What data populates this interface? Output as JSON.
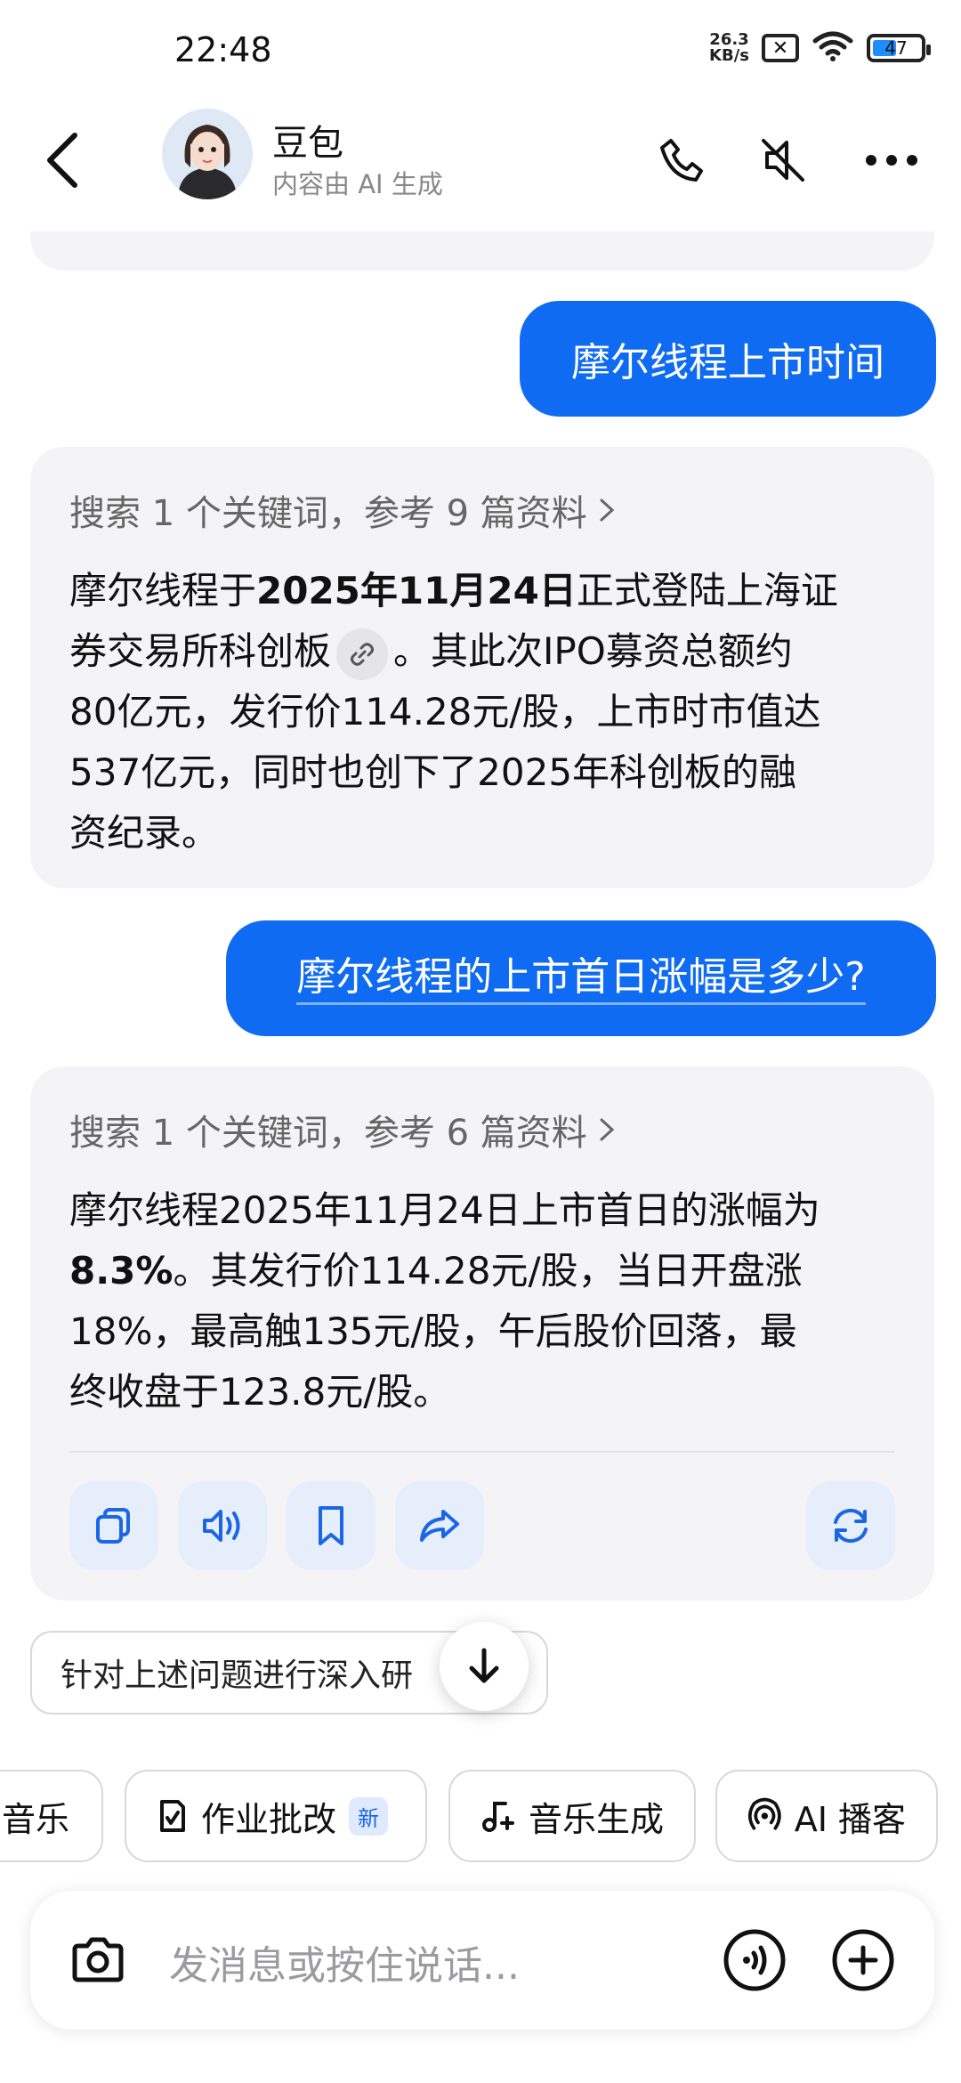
{
  "status": {
    "time": "22:48",
    "net_speed_value": "26.3",
    "net_speed_unit": "KB/s",
    "battery_level": "47"
  },
  "header": {
    "title": "豆包",
    "subtitle": "内容由 AI 生成"
  },
  "chat": {
    "messages": [
      {
        "role": "user",
        "text": "摩尔线程上市时间"
      },
      {
        "role": "ai",
        "search": "搜索 1 个关键词，参考 9 篇资料",
        "p1_a": "摩尔线程于",
        "p1_bold": "2025年11月24日",
        "p1_b": "正式登陆上海证",
        "p2_a": "券交易所科创板",
        "p2_b": "。其此次IPO募资总额约",
        "p3": "80亿元，发行价114.28元/股，上市时市值达",
        "p4": "537亿元，同时也创下了2025年科创板的融",
        "p5": "资纪录。"
      },
      {
        "role": "user",
        "text": "摩尔线程的上市首日涨幅是多少?"
      },
      {
        "role": "ai",
        "search": "搜索 1 个关键词，参考 6 篇资料",
        "p1": "摩尔线程2025年11月24日上市首日的涨幅为",
        "p2_bold": "8.3%",
        "p2_b": "。其发行价114.28元/股，当日开盘涨",
        "p3": "18%，最高触135元/股，午后股价回落，最",
        "p4": "终收盘于123.8元/股。"
      }
    ]
  },
  "suggestion": "针对上述问题进行深入研",
  "tools": [
    {
      "label": "音乐",
      "icon": "music-icon"
    },
    {
      "label": "作业批改",
      "badge": "新",
      "icon": "homework-icon"
    },
    {
      "label": "音乐生成",
      "icon": "music-note-icon"
    },
    {
      "label": "AI 播客",
      "icon": "podcast-icon"
    }
  ],
  "input": {
    "placeholder": "发消息或按住说话..."
  },
  "colors": {
    "accent": "#0f6bf2",
    "bubble_bg": "#f4f4f6"
  }
}
